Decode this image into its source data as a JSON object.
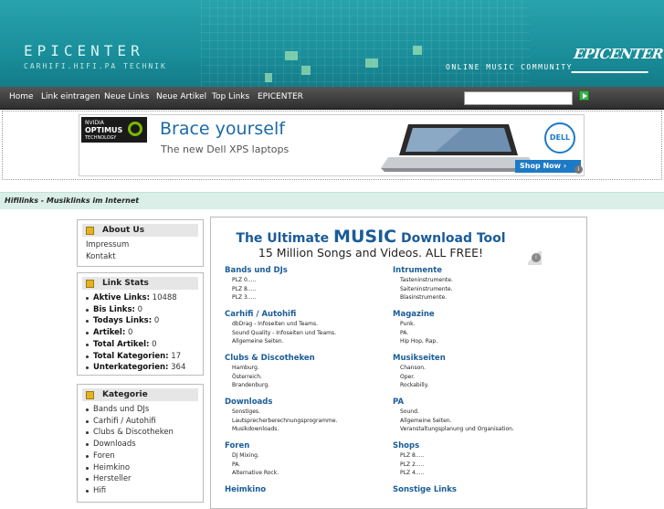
{
  "header": {
    "site_title": "EPICENTER",
    "site_subtitle": "CARHIFI.HIFI.PA TECHNIK",
    "community": "ONLINE MUSIC COMMUNITY",
    "logo_text": "EPICENTER"
  },
  "nav": {
    "items": [
      "Home",
      "Link eintragen",
      "Neue Links",
      "Neue Artikel",
      "Top Links",
      "EPICENTER"
    ],
    "search_value": ""
  },
  "banner_ad": {
    "nvidia_line1": "NVIDIA",
    "nvidia_line2": "OPTIMUS",
    "nvidia_line3": "TECHNOLOGY",
    "headline": "Brace yourself",
    "subline": "The new Dell XPS laptops",
    "brand": "DELL",
    "cta": "Shop Now ›",
    "info": "i"
  },
  "breadcrumb": "Hifilinks - Musiklinks im Internet",
  "sidebar": {
    "about": {
      "title": "About Us",
      "items": [
        "Impressum",
        "Kontakt"
      ]
    },
    "stats": {
      "title": "Link Stats",
      "items": [
        {
          "label": "Aktive Links:",
          "value": "10488"
        },
        {
          "label": "Bis Links:",
          "value": "0"
        },
        {
          "label": "Todays Links:",
          "value": "0"
        },
        {
          "label": "Artikel:",
          "value": "0"
        },
        {
          "label": "Total Artikel:",
          "value": "0"
        },
        {
          "label": "Total Kategorien:",
          "value": "17"
        },
        {
          "label": "Unterkategorien:",
          "value": "364"
        }
      ]
    },
    "categories": {
      "title": "Kategorie",
      "items": [
        "Bands und DJs",
        "Carhifi / Autohifi",
        "Clubs & Discotheken",
        "Downloads",
        "Foren",
        "Heimkino",
        "Hersteller",
        "Hifi"
      ]
    }
  },
  "main": {
    "ad_title_pre": "The Ultimate",
    "ad_title_big": "MUSIC",
    "ad_title_post": "Download Tool",
    "ad_sub": "15 Million Songs and Videos. ALL FREE!",
    "left_categories": [
      {
        "title": "Bands und DJs",
        "subs": [
          "PLZ 0.....",
          "PLZ 8.....",
          "PLZ 3....."
        ]
      },
      {
        "title": "Carhifi / Autohifi",
        "subs": [
          "dbDrag - Infoseiten und Teams.",
          "Sound Quality - Infoseiten und Teams.",
          "Allgemeine Seiten."
        ]
      },
      {
        "title": "Clubs & Discotheken",
        "subs": [
          "Hamburg.",
          "Österreich.",
          "Brandenburg."
        ]
      },
      {
        "title": "Downloads",
        "subs": [
          "Sonstiges.",
          "Lautsprecherberechnungsprogramme.",
          "Musikdownloads."
        ]
      },
      {
        "title": "Foren",
        "subs": [
          "DJ Mixing.",
          "PA.",
          "Alternative Rock."
        ]
      },
      {
        "title": "Heimkino",
        "subs": []
      }
    ],
    "right_categories": [
      {
        "title": "Intrumente",
        "subs": [
          "Tasteninstrumente.",
          "Saiteninstrumente.",
          "Blasinstrumente."
        ]
      },
      {
        "title": "Magazine",
        "subs": [
          "Punk.",
          "PA.",
          "Hip Hop, Rap."
        ]
      },
      {
        "title": "Musikseiten",
        "subs": [
          "Chanson.",
          "Oper.",
          "Rockabilly."
        ]
      },
      {
        "title": "PA",
        "subs": [
          "Sound.",
          "Allgemeine Seiten.",
          "Veranstaltungsplanung und Organisation."
        ]
      },
      {
        "title": "Shops",
        "subs": [
          "PLZ 8.....",
          "PLZ 2.....",
          "PLZ 4....."
        ]
      },
      {
        "title": "Sonstige Links",
        "subs": []
      }
    ]
  }
}
